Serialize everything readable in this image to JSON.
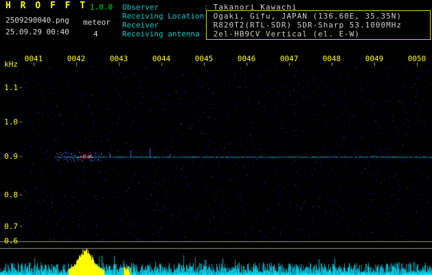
{
  "header": {
    "app_title": "H R O F F T",
    "version": "1.0.0",
    "filename": "2509290040.png",
    "mode": "meteor",
    "timestamp": "25.09.29 00:40",
    "count": "4",
    "colon": ":",
    "info": [
      {
        "label": "Observer",
        "value": "Takanori Kawachi"
      },
      {
        "label": "Receiving Location",
        "value": "Ogaki, Gifu, JAPAN (136.60E, 35.35N)"
      },
      {
        "label": "Receiver",
        "value": "R820T2(RTL-SDR) SDR-Sharp 53.1000MHz"
      },
      {
        "label": "Receiving antenna",
        "value": "2el-HB9CV Vertical (el. E-W)"
      }
    ]
  },
  "chart_data": {
    "type": "heatmap",
    "title": "HROFFT meteor echo spectrogram",
    "ylabel": "kHz",
    "x_ticks": [
      "0041",
      "0042",
      "0043",
      "0044",
      "0045",
      "0046",
      "0047",
      "0048",
      "0049",
      "0050"
    ],
    "y_ticks": [
      "1.1",
      "1.0",
      "0.9",
      "0.8",
      "0.7",
      "0.6"
    ],
    "ylim": [
      0.6,
      1.15
    ],
    "time_span": "00:40 - 00:50",
    "carrier_trace_khz": 0.9,
    "carrier_trace_start": "0041",
    "echo_event": {
      "time": "0042",
      "freq_khz": 0.9,
      "color": "red"
    },
    "echo_count": 4,
    "bottom_strip": "signal level vs time (cyan noise floor)",
    "level_peak_time": "0042"
  },
  "colors": {
    "background": "#000000",
    "accent_yellow": "#ffff00",
    "version_green": "#00dd00",
    "label_cyan": "#00cccc",
    "value_white": "#d0d0d0",
    "noise_blue": "#2233bb",
    "trace_cyan": "#00b4cc",
    "echo_red": "#ff2a00",
    "strip_cyan": "#00c2d6",
    "separator_line": "#9a9a85"
  }
}
